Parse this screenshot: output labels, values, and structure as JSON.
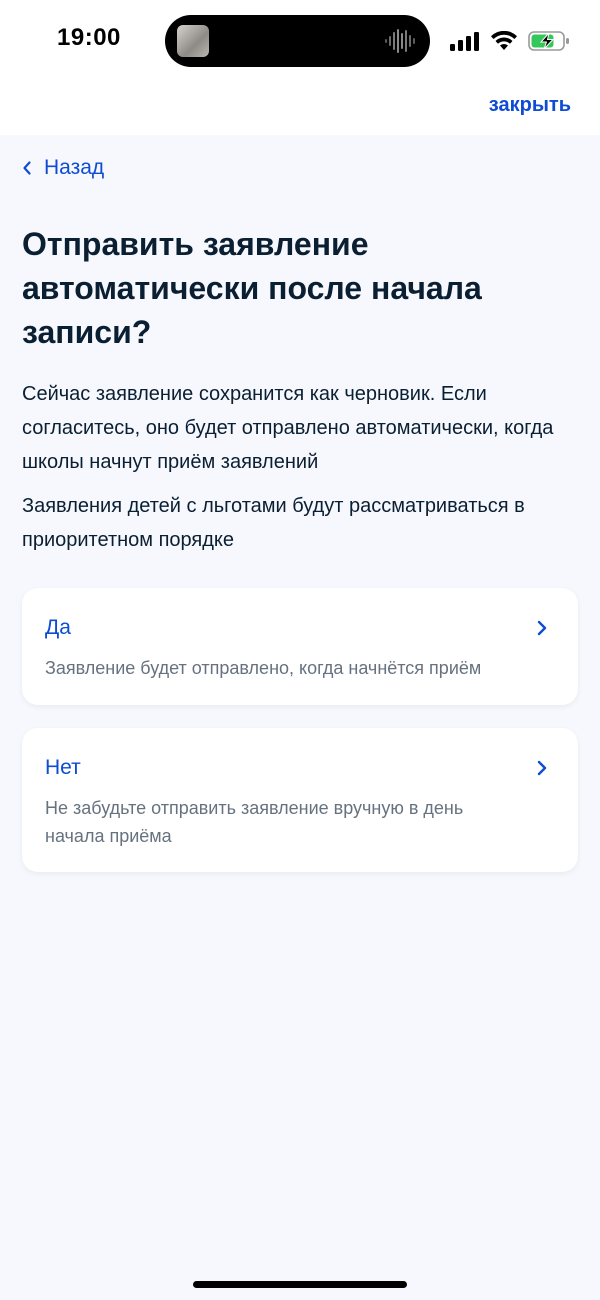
{
  "status_bar": {
    "time": "19:00",
    "icons": [
      "signal-icon",
      "wifi-icon",
      "battery-charging-icon"
    ]
  },
  "header": {
    "close_label": "закрыть"
  },
  "nav": {
    "back_label": "Назад"
  },
  "main": {
    "title": "Отправить заявление автоматически после начала записи?",
    "paragraphs": [
      "Сейчас заявление сохранится как черновик. Если согласитесь, оно будет отправлено автоматически, когда школы начнут приём заявлений",
      "Заявления детей с льготами будут рассматриваться в приоритетном порядке"
    ],
    "options": [
      {
        "label": "Да",
        "description": "Заявление будет отправлено, когда начнётся приём"
      },
      {
        "label": "Нет",
        "description": "Не забудьте отправить заявление вручную в день начала приёма"
      }
    ]
  },
  "colors": {
    "accent": "#0d4cd3",
    "text_primary": "#0b1f33",
    "text_secondary": "#66727f",
    "page_background": "#f6f8fd",
    "card_background": "#ffffff",
    "battery_green": "#34c759"
  }
}
